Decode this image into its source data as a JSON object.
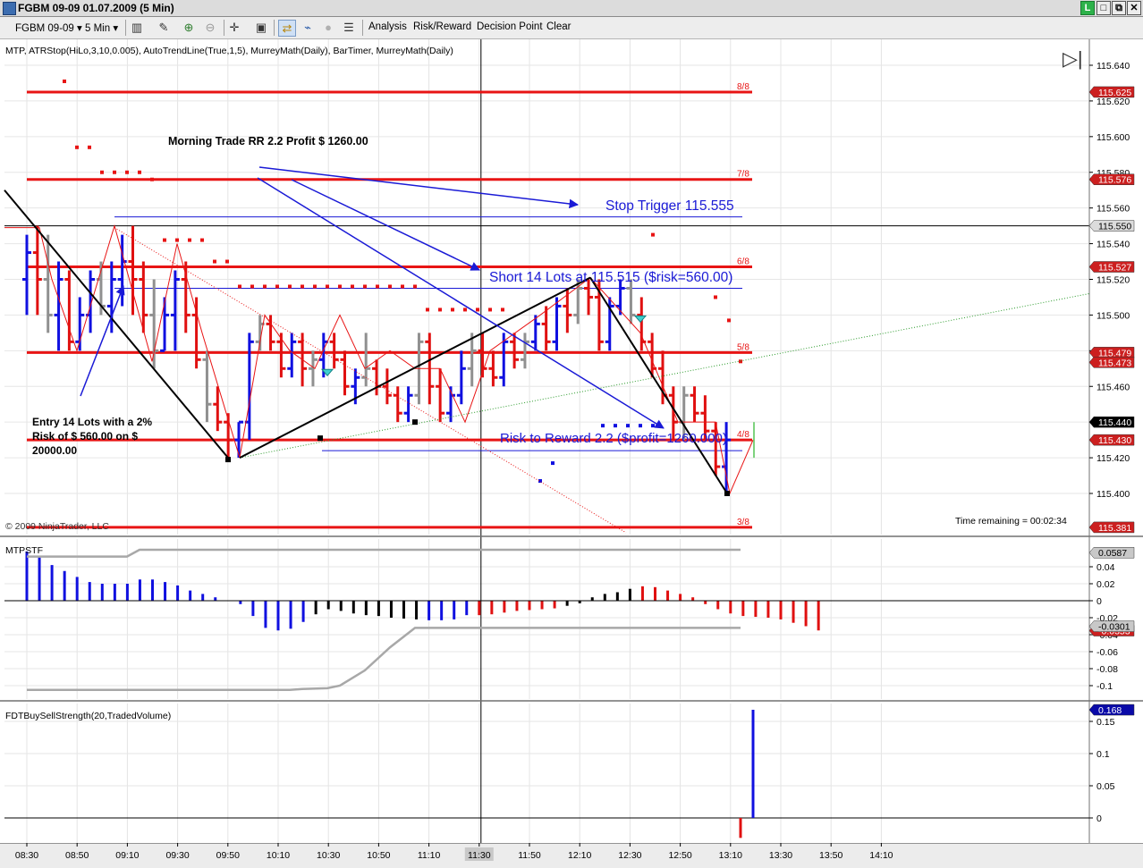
{
  "window": {
    "title": "FGBM 09-09  01.07.2009 (5 Min)",
    "buttons": {
      "l": "L",
      "restore": "□",
      "max": "⧉",
      "close": "✕"
    }
  },
  "toolbar": {
    "instrument": "FGBM 09-09",
    "interval": "5 Min",
    "analysis": "Analysis",
    "risk_reward": "Risk/Reward",
    "decision_point": "Decision Point",
    "clear": "Clear",
    "icons": [
      "bar-type-icon",
      "draw-pencil-icon",
      "zoom-in-icon",
      "zoom-out-icon",
      "crosshair-icon",
      "data-box-icon",
      "chart-trader-icon",
      "strategy-icon",
      "hotkey-icon",
      "properties-icon"
    ]
  },
  "price_panel": {
    "indicators_label": "MTP, ATRStop(HiLo,3,10,0.005), AutoTrendLine(True,1,5), MurreyMath(Daily), BarTimer, MurreyMath(Daily)",
    "copyright": "© 2009 NinjaTrader, LLC",
    "time_remaining": "Time remaining = 00:02:34",
    "y_ticks": [
      "115.640",
      "115.620",
      "115.600",
      "115.580",
      "115.560",
      "115.540",
      "115.520",
      "115.500",
      "115.480",
      "115.460",
      "115.440",
      "115.420",
      "115.400"
    ],
    "y_axis": {
      "min": 115.376,
      "max": 115.648
    },
    "murrey_lines": [
      {
        "label": "8/8",
        "price": 115.625,
        "tag": "115.625"
      },
      {
        "label": "7/8",
        "price": 115.576,
        "tag": "115.576"
      },
      {
        "label": "6/8",
        "price": 115.527,
        "tag": "115.527"
      },
      {
        "label": "5/8",
        "price": 115.479,
        "tag": "115.479"
      },
      {
        "label": "4/8",
        "price": 115.43,
        "tag": "115.430"
      },
      {
        "label": "3/8",
        "price": 115.381,
        "tag": "115.381"
      }
    ],
    "other_tags": [
      {
        "text": "115.550",
        "price": 115.55,
        "bg": "#dcdcdc",
        "fg": "#000000"
      },
      {
        "text": "115.473",
        "price": 115.4735,
        "bg": "#cc1f1f",
        "fg": "#ffffff"
      },
      {
        "text": "115.440",
        "price": 115.44,
        "bg": "#000000",
        "fg": "#ffffff"
      }
    ],
    "annotations": {
      "morning_trade": "Morning Trade RR 2.2 Profit $ 1260.00",
      "stop_trigger": "Stop Trigger 115.555",
      "short_entry": "Short 14 Lots at 115.515 ($risk=560.00)",
      "risk_reward": "Risk to Reward 2.2 ($profit=1260.000)",
      "entry_note": [
        "Entry 14 Lots with a 2%",
        "Risk of $ 560.00 on $",
        "20000.00"
      ]
    }
  },
  "mtpstf_panel": {
    "label": "MTPSTF",
    "y_ticks": [
      "0.04",
      "0.02",
      "0",
      "-0.02",
      "-0.04",
      "-0.06",
      "-0.08",
      "-0.1"
    ],
    "tags": [
      {
        "text": "0.0587",
        "value": 0.0587
      },
      {
        "text": "-0.0301",
        "value": -0.0301
      },
      {
        "text": "-0.0353",
        "value": -0.0353
      }
    ]
  },
  "strength_panel": {
    "label": "FDTBuySellStrength(20,TradedVolume)",
    "y_ticks": [
      "0.15",
      "0.1",
      "0.05",
      "0"
    ],
    "tag": "0.168"
  },
  "x_axis": {
    "labels": [
      "08:30",
      "08:50",
      "09:10",
      "09:30",
      "09:50",
      "10:10",
      "10:30",
      "10:50",
      "11:10",
      "11:30",
      "11:50",
      "12:10",
      "12:30",
      "12:50",
      "13:10",
      "13:30",
      "13:50",
      "14:10"
    ],
    "highlighted": "11:30"
  },
  "colors": {
    "murrey": "#e81414",
    "up_bar": "#1010e0",
    "down_bar": "#e01010",
    "neutral_bar": "#909090",
    "annotation_blue": "#1a1ad6",
    "tag_red": "#cc1f1f",
    "tag_blue": "#0a0aa8"
  }
}
